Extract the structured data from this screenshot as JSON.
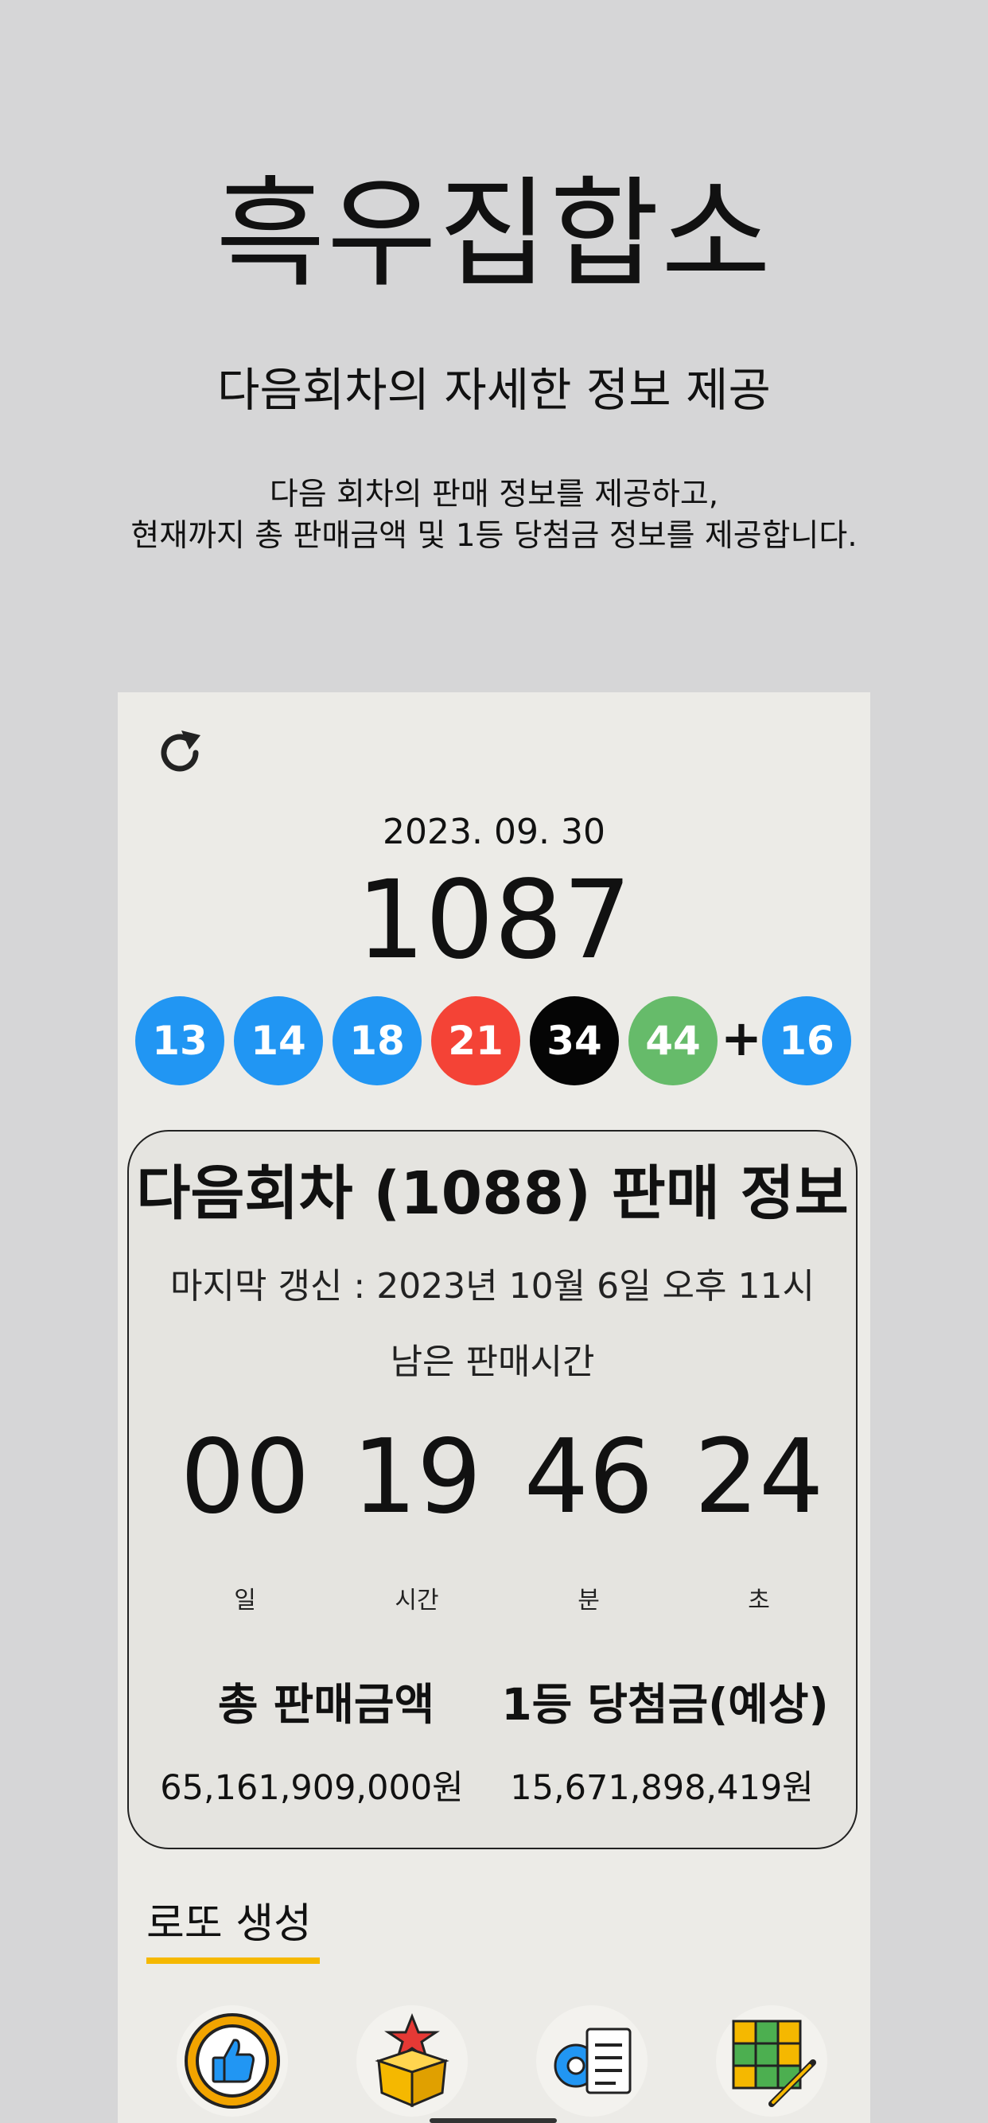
{
  "header": {
    "title": "흑우집합소",
    "subtitle": "다음회차의 자세한 정보 제공",
    "description_line1": "다음 회차의 판매 정보를 제공하고,",
    "description_line2": "현재까지 총 판매금액 및 1등 당첨금 정보를 제공합니다."
  },
  "last_draw": {
    "date": "2023. 09. 30",
    "round": "1087",
    "numbers": [
      {
        "value": "13",
        "color": "#2196f3"
      },
      {
        "value": "14",
        "color": "#2196f3"
      },
      {
        "value": "18",
        "color": "#2196f3"
      },
      {
        "value": "21",
        "color": "#f44336"
      },
      {
        "value": "34",
        "color": "#050505"
      },
      {
        "value": "44",
        "color": "#66bb6a"
      }
    ],
    "plus": "+",
    "bonus": {
      "value": "16",
      "color": "#2196f3"
    }
  },
  "next_sale": {
    "title": "다음회차 (1088) 판매 정보",
    "last_update": "마지막 갱신 : 2023년 10월 6일 오후 11시",
    "remaining_label": "남은 판매시간",
    "countdown": {
      "days": "00",
      "hours": "19",
      "minutes": "46",
      "seconds": "24",
      "days_unit": "일",
      "hours_unit": "시간",
      "minutes_unit": "분",
      "seconds_unit": "초"
    },
    "total_sales_label": "총 판매금액",
    "total_sales_value": "65,161,909,000원",
    "first_prize_label": "1등 당첨금(예상)",
    "first_prize_value": "15,671,898,419원"
  },
  "generator": {
    "title": "로또 생성",
    "icons": [
      "thumbs-up-badge-icon",
      "star-box-icon",
      "settings-document-icon",
      "number-grid-pencil-icon"
    ]
  },
  "colors": {
    "background": "#d6d6d7",
    "card": "#ecebe7",
    "accent": "#f5b800"
  }
}
